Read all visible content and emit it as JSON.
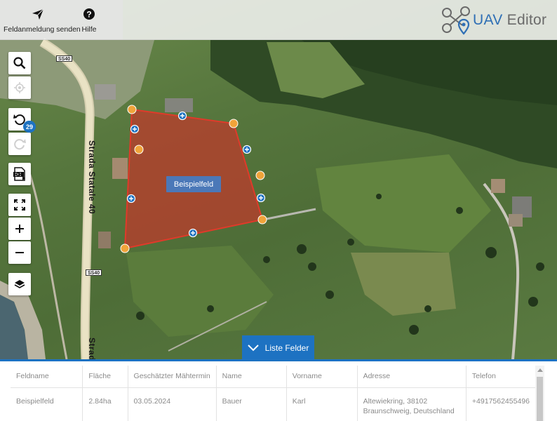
{
  "topbar": {
    "feldanmeldung_label": "Feldanmeldung senden",
    "hilfe_label": "Hilfe",
    "logo_uav": "UAV",
    "logo_editor": "Editor"
  },
  "map": {
    "road_label": "Strada Statale 40",
    "road_label_bottom": "Strad",
    "road_shield": "SS40",
    "field_label": "Beispielfeld",
    "undo_count": "29"
  },
  "tools": [
    "search-icon",
    "locate-icon",
    "undo-icon",
    "redo-icon",
    "csv-export-icon",
    "fullscreen-icon",
    "zoom-in-icon",
    "zoom-out-icon",
    "layers-icon"
  ],
  "list": {
    "toggle_label": "Liste Felder",
    "columns": [
      "Feldname",
      "Fläche",
      "Geschätzter Mähtermin",
      "Name",
      "Vorname",
      "Adresse",
      "Telefon"
    ],
    "rows": [
      {
        "feldname": "Beispielfeld",
        "flaeche": "2.84ha",
        "maehtermin": "03.05.2024",
        "name": "Bauer",
        "vorname": "Karl",
        "adresse": "Altewiekring, 38102 Braunschweig, Deutschland",
        "telefon": "+4917562455496"
      }
    ]
  },
  "colors": {
    "accent": "#1d72c2",
    "field_fill": "#c0392b",
    "vertex": "#f0a43a",
    "midpoint": "#1e73c2"
  }
}
